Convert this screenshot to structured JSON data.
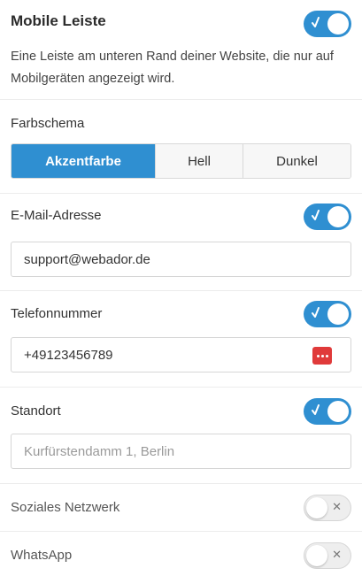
{
  "header": {
    "title": "Mobile Leiste",
    "description": "Eine Leiste am unteren Rand deiner Website, die nur auf Mobilgeräten angezeigt wird.",
    "enabled": true
  },
  "color_scheme": {
    "label": "Farbschema",
    "options": [
      "Akzentfarbe",
      "Hell",
      "Dunkel"
    ],
    "selected": "Akzentfarbe"
  },
  "email": {
    "label": "E-Mail-Adresse",
    "enabled": true,
    "value": "support@webador.de"
  },
  "phone": {
    "label": "Telefonnummer",
    "enabled": true,
    "value": "+49123456789",
    "password_manager_icon": "password-manager-icon"
  },
  "location": {
    "label": "Standort",
    "enabled": true,
    "value": "",
    "placeholder": "Kurfürstendamm 1, Berlin"
  },
  "social": {
    "label": "Soziales Netzwerk",
    "enabled": false
  },
  "whatsapp": {
    "label": "WhatsApp",
    "enabled": false
  },
  "colors": {
    "accent": "#2f8fd1",
    "password_icon": "#e03a3a"
  }
}
